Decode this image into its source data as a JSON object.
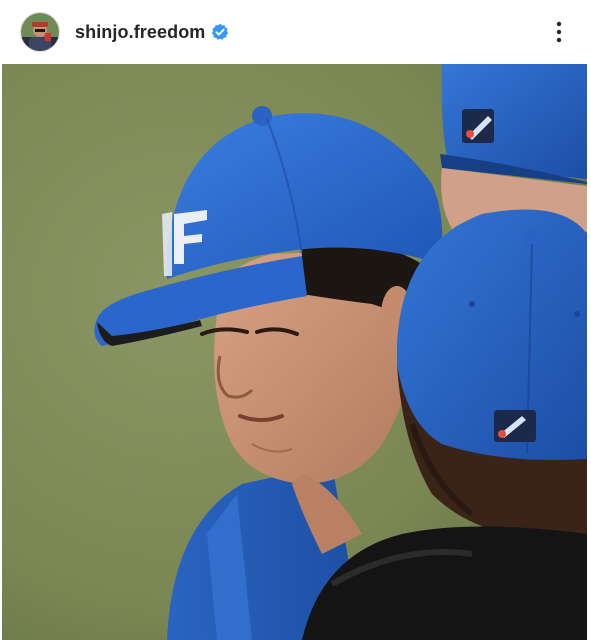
{
  "post": {
    "author": {
      "username": "shinjo.freedom",
      "verified": true,
      "avatar_icon": "profile-avatar",
      "verified_icon": "verified-badge-icon"
    },
    "menu_icon": "more-options-icon",
    "accent_color": "#3897f0",
    "photo": {
      "alt_description": "",
      "cap_color": "#2f6fd1",
      "field_color": "#7d8a55"
    }
  }
}
